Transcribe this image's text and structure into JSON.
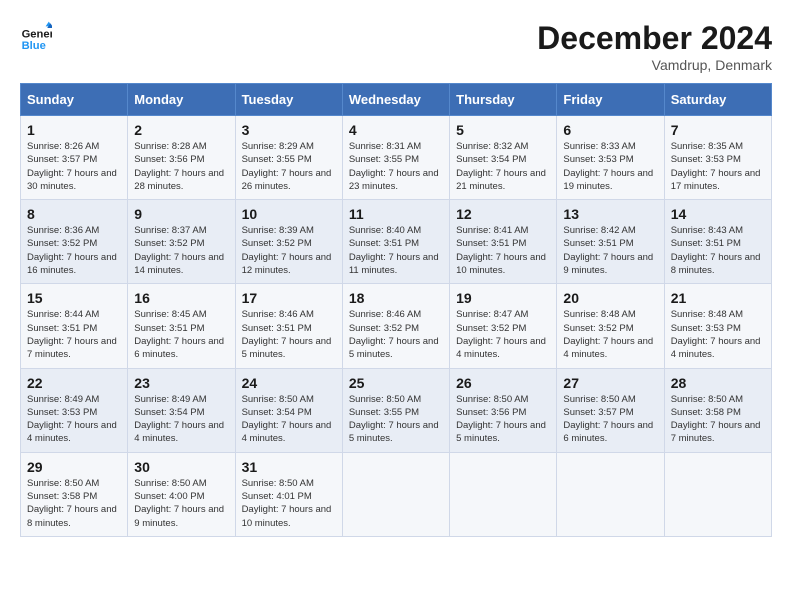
{
  "header": {
    "logo_line1": "General",
    "logo_line2": "Blue",
    "month": "December 2024",
    "location": "Vamdrup, Denmark"
  },
  "weekdays": [
    "Sunday",
    "Monday",
    "Tuesday",
    "Wednesday",
    "Thursday",
    "Friday",
    "Saturday"
  ],
  "weeks": [
    [
      {
        "day": "1",
        "sunrise": "Sunrise: 8:26 AM",
        "sunset": "Sunset: 3:57 PM",
        "daylight": "Daylight: 7 hours and 30 minutes."
      },
      {
        "day": "2",
        "sunrise": "Sunrise: 8:28 AM",
        "sunset": "Sunset: 3:56 PM",
        "daylight": "Daylight: 7 hours and 28 minutes."
      },
      {
        "day": "3",
        "sunrise": "Sunrise: 8:29 AM",
        "sunset": "Sunset: 3:55 PM",
        "daylight": "Daylight: 7 hours and 26 minutes."
      },
      {
        "day": "4",
        "sunrise": "Sunrise: 8:31 AM",
        "sunset": "Sunset: 3:55 PM",
        "daylight": "Daylight: 7 hours and 23 minutes."
      },
      {
        "day": "5",
        "sunrise": "Sunrise: 8:32 AM",
        "sunset": "Sunset: 3:54 PM",
        "daylight": "Daylight: 7 hours and 21 minutes."
      },
      {
        "day": "6",
        "sunrise": "Sunrise: 8:33 AM",
        "sunset": "Sunset: 3:53 PM",
        "daylight": "Daylight: 7 hours and 19 minutes."
      },
      {
        "day": "7",
        "sunrise": "Sunrise: 8:35 AM",
        "sunset": "Sunset: 3:53 PM",
        "daylight": "Daylight: 7 hours and 17 minutes."
      }
    ],
    [
      {
        "day": "8",
        "sunrise": "Sunrise: 8:36 AM",
        "sunset": "Sunset: 3:52 PM",
        "daylight": "Daylight: 7 hours and 16 minutes."
      },
      {
        "day": "9",
        "sunrise": "Sunrise: 8:37 AM",
        "sunset": "Sunset: 3:52 PM",
        "daylight": "Daylight: 7 hours and 14 minutes."
      },
      {
        "day": "10",
        "sunrise": "Sunrise: 8:39 AM",
        "sunset": "Sunset: 3:52 PM",
        "daylight": "Daylight: 7 hours and 12 minutes."
      },
      {
        "day": "11",
        "sunrise": "Sunrise: 8:40 AM",
        "sunset": "Sunset: 3:51 PM",
        "daylight": "Daylight: 7 hours and 11 minutes."
      },
      {
        "day": "12",
        "sunrise": "Sunrise: 8:41 AM",
        "sunset": "Sunset: 3:51 PM",
        "daylight": "Daylight: 7 hours and 10 minutes."
      },
      {
        "day": "13",
        "sunrise": "Sunrise: 8:42 AM",
        "sunset": "Sunset: 3:51 PM",
        "daylight": "Daylight: 7 hours and 9 minutes."
      },
      {
        "day": "14",
        "sunrise": "Sunrise: 8:43 AM",
        "sunset": "Sunset: 3:51 PM",
        "daylight": "Daylight: 7 hours and 8 minutes."
      }
    ],
    [
      {
        "day": "15",
        "sunrise": "Sunrise: 8:44 AM",
        "sunset": "Sunset: 3:51 PM",
        "daylight": "Daylight: 7 hours and 7 minutes."
      },
      {
        "day": "16",
        "sunrise": "Sunrise: 8:45 AM",
        "sunset": "Sunset: 3:51 PM",
        "daylight": "Daylight: 7 hours and 6 minutes."
      },
      {
        "day": "17",
        "sunrise": "Sunrise: 8:46 AM",
        "sunset": "Sunset: 3:51 PM",
        "daylight": "Daylight: 7 hours and 5 minutes."
      },
      {
        "day": "18",
        "sunrise": "Sunrise: 8:46 AM",
        "sunset": "Sunset: 3:52 PM",
        "daylight": "Daylight: 7 hours and 5 minutes."
      },
      {
        "day": "19",
        "sunrise": "Sunrise: 8:47 AM",
        "sunset": "Sunset: 3:52 PM",
        "daylight": "Daylight: 7 hours and 4 minutes."
      },
      {
        "day": "20",
        "sunrise": "Sunrise: 8:48 AM",
        "sunset": "Sunset: 3:52 PM",
        "daylight": "Daylight: 7 hours and 4 minutes."
      },
      {
        "day": "21",
        "sunrise": "Sunrise: 8:48 AM",
        "sunset": "Sunset: 3:53 PM",
        "daylight": "Daylight: 7 hours and 4 minutes."
      }
    ],
    [
      {
        "day": "22",
        "sunrise": "Sunrise: 8:49 AM",
        "sunset": "Sunset: 3:53 PM",
        "daylight": "Daylight: 7 hours and 4 minutes."
      },
      {
        "day": "23",
        "sunrise": "Sunrise: 8:49 AM",
        "sunset": "Sunset: 3:54 PM",
        "daylight": "Daylight: 7 hours and 4 minutes."
      },
      {
        "day": "24",
        "sunrise": "Sunrise: 8:50 AM",
        "sunset": "Sunset: 3:54 PM",
        "daylight": "Daylight: 7 hours and 4 minutes."
      },
      {
        "day": "25",
        "sunrise": "Sunrise: 8:50 AM",
        "sunset": "Sunset: 3:55 PM",
        "daylight": "Daylight: 7 hours and 5 minutes."
      },
      {
        "day": "26",
        "sunrise": "Sunrise: 8:50 AM",
        "sunset": "Sunset: 3:56 PM",
        "daylight": "Daylight: 7 hours and 5 minutes."
      },
      {
        "day": "27",
        "sunrise": "Sunrise: 8:50 AM",
        "sunset": "Sunset: 3:57 PM",
        "daylight": "Daylight: 7 hours and 6 minutes."
      },
      {
        "day": "28",
        "sunrise": "Sunrise: 8:50 AM",
        "sunset": "Sunset: 3:58 PM",
        "daylight": "Daylight: 7 hours and 7 minutes."
      }
    ],
    [
      {
        "day": "29",
        "sunrise": "Sunrise: 8:50 AM",
        "sunset": "Sunset: 3:58 PM",
        "daylight": "Daylight: 7 hours and 8 minutes."
      },
      {
        "day": "30",
        "sunrise": "Sunrise: 8:50 AM",
        "sunset": "Sunset: 4:00 PM",
        "daylight": "Daylight: 7 hours and 9 minutes."
      },
      {
        "day": "31",
        "sunrise": "Sunrise: 8:50 AM",
        "sunset": "Sunset: 4:01 PM",
        "daylight": "Daylight: 7 hours and 10 minutes."
      },
      null,
      null,
      null,
      null
    ]
  ]
}
